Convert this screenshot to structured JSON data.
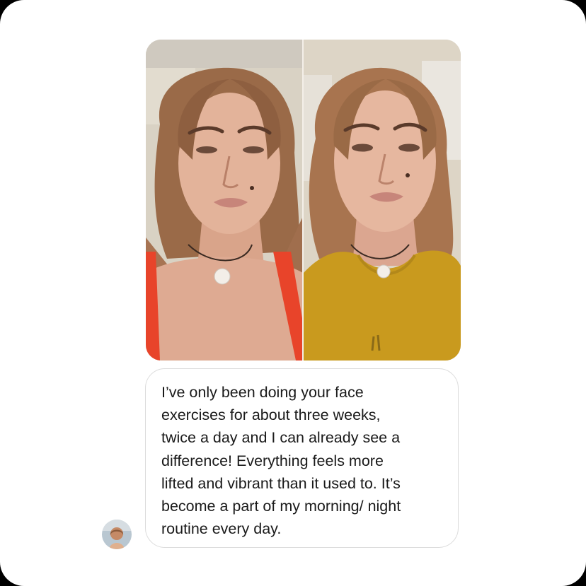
{
  "conversation": {
    "message": {
      "text": "I’ve only been doing your face\nexercises for about three weeks,\ntwice a day and I can already see a\ndifference! Everything feels more\nlifted and vibrant than it used to. It’s\nbecome a part of my morning/ night\nroutine every day.",
      "sender_avatar": "avatar"
    },
    "attachment": {
      "type": "before-after-photo",
      "panels": [
        "before",
        "after"
      ]
    }
  },
  "colors": {
    "page_background": "#ffffff",
    "frame_background": "#000000",
    "bubble_border": "#dcdcdc",
    "text": "#1a1a1a",
    "before_top": "#e8442a",
    "after_top": "#c99a1e"
  }
}
